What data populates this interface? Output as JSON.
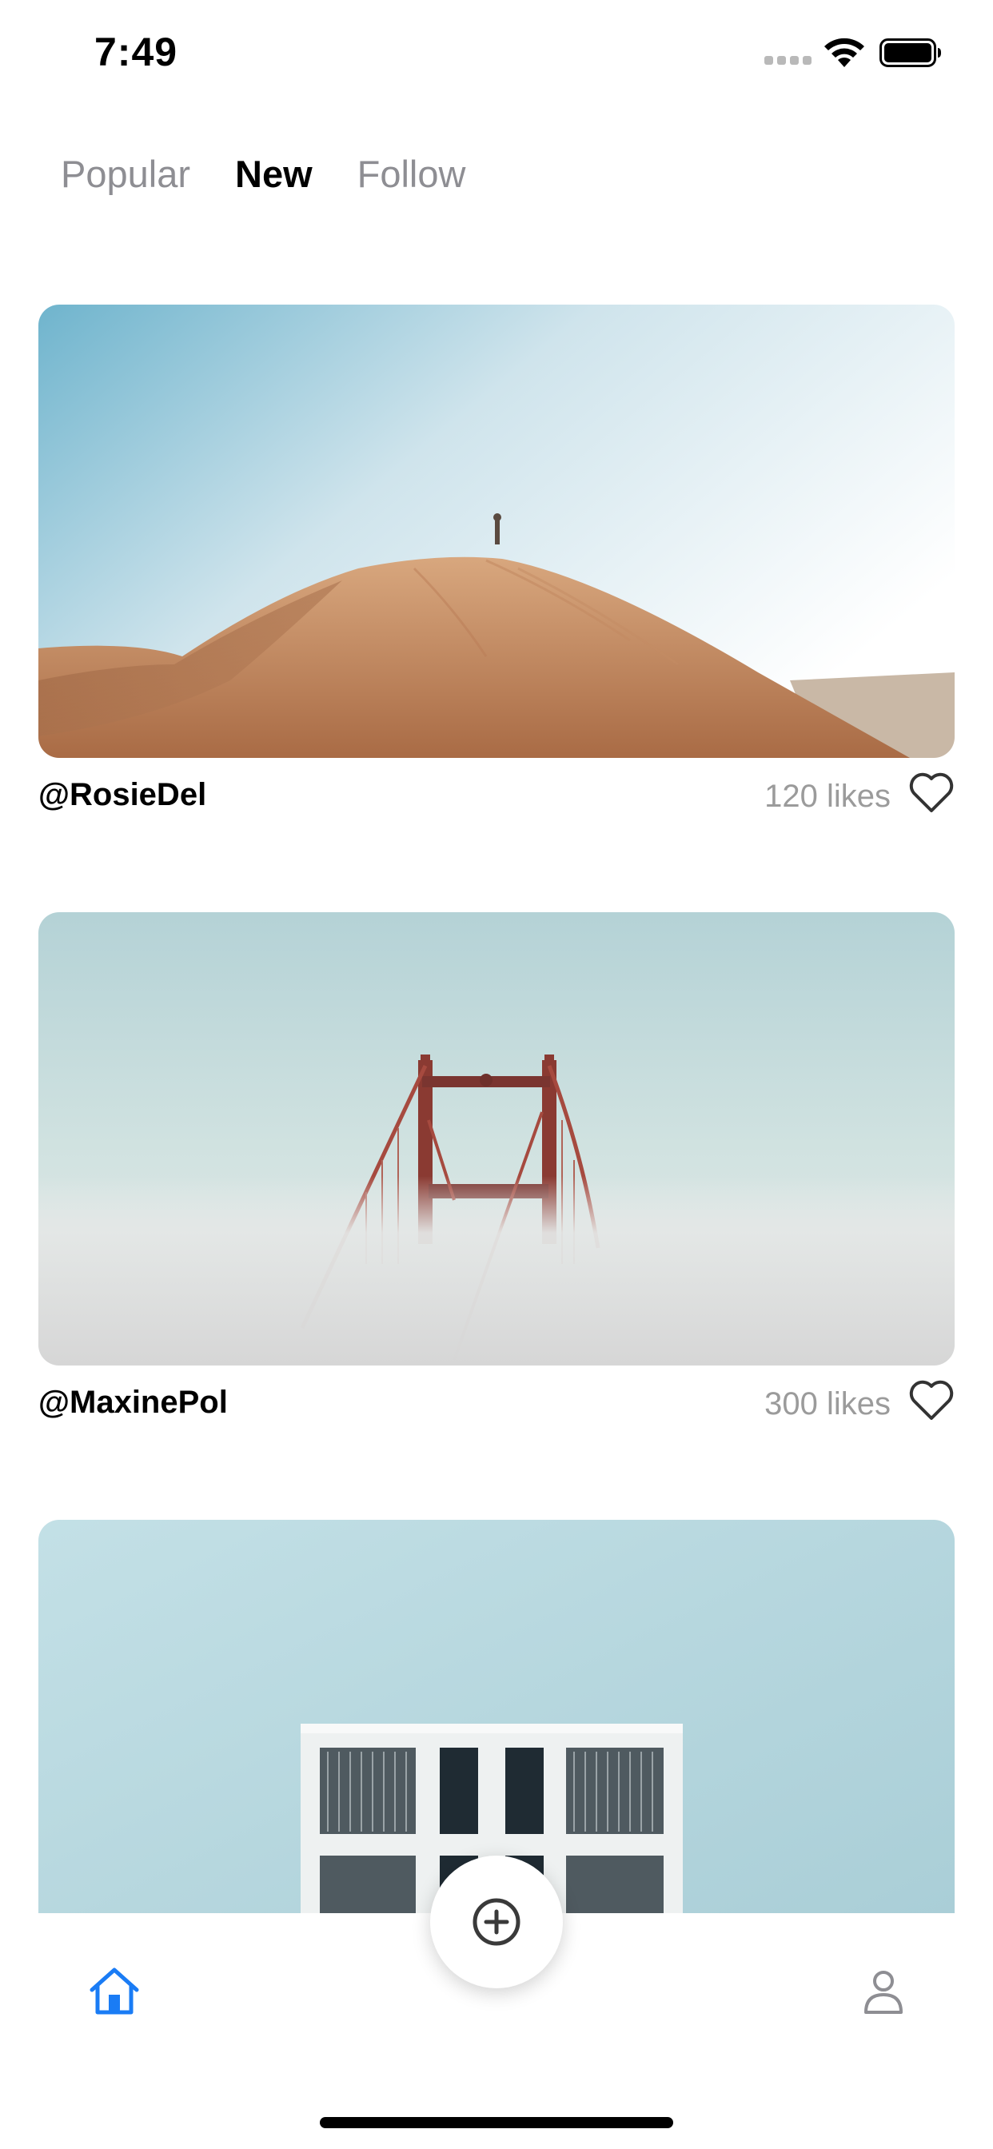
{
  "status_bar": {
    "time": "7:49",
    "icons": [
      "cellular-signal-icon",
      "wifi-icon",
      "battery-icon"
    ]
  },
  "tabs": [
    {
      "label": "Popular",
      "active": false
    },
    {
      "label": "New",
      "active": true
    },
    {
      "label": "Follow",
      "active": false
    }
  ],
  "feed": [
    {
      "author": "@RosieDel",
      "likes": "120 likes",
      "photo": "desert-dune-photo",
      "liked": false
    },
    {
      "author": "@MaxinePol",
      "likes": "300 likes",
      "photo": "bridge-in-fog-photo",
      "liked": false
    },
    {
      "author": "",
      "likes": "",
      "photo": "white-building-photo",
      "liked": false
    }
  ],
  "bottom_bar": {
    "items": [
      "home-icon",
      "add-post-icon",
      "profile-icon"
    ],
    "active": "home-icon"
  },
  "colors": {
    "accent": "#1a7cf5",
    "inactive_tab": "#8e8e93",
    "likes_text": "#9b9b9b"
  }
}
